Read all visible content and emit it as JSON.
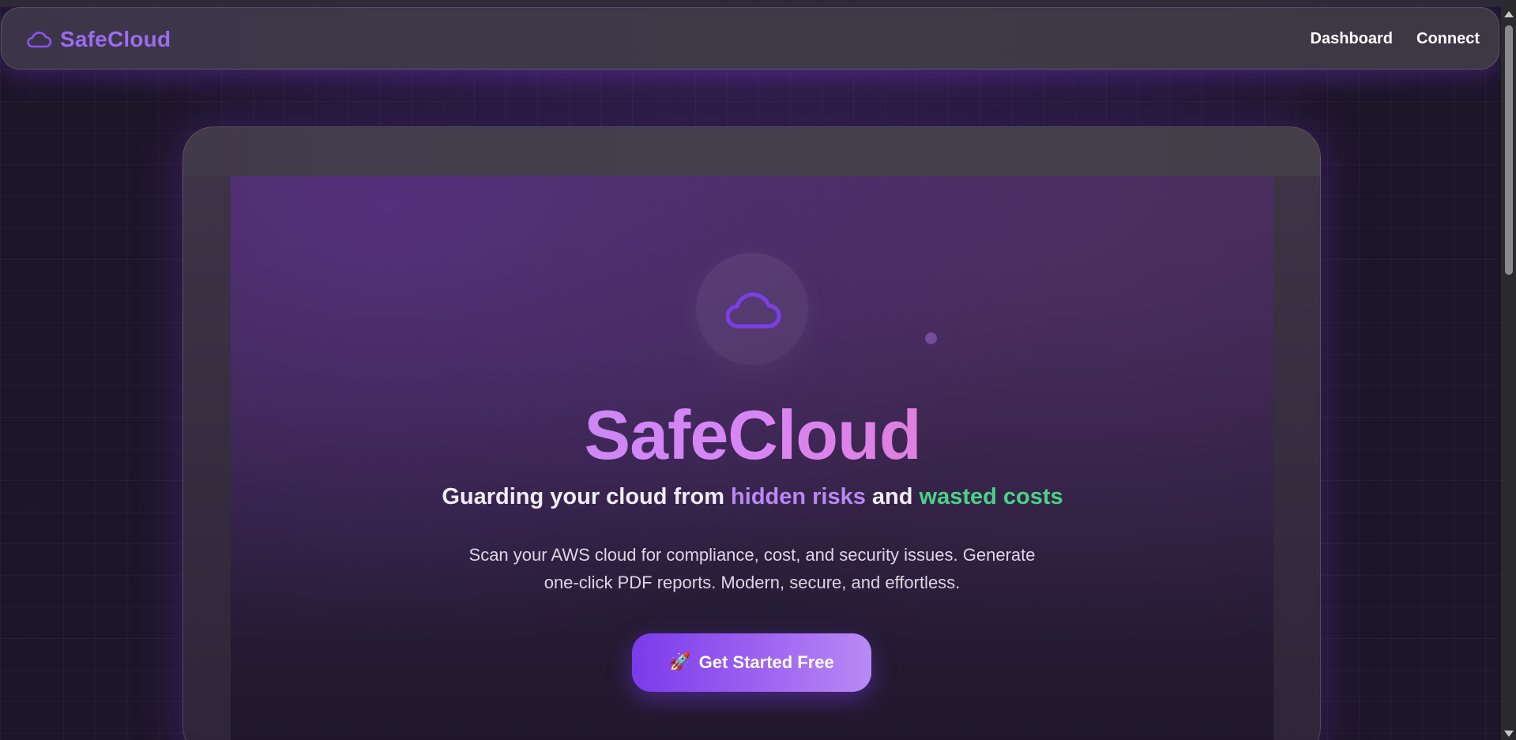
{
  "brand": {
    "name": "SafeCloud",
    "icon": "cloud-icon",
    "color": "#9b6cf0"
  },
  "nav": {
    "links": [
      {
        "label": "Dashboard"
      },
      {
        "label": "Connect"
      }
    ]
  },
  "hero": {
    "icon": "cloud-icon",
    "title": "SafeCloud",
    "tagline": {
      "prefix": "Guarding your cloud from ",
      "highlight1": "hidden risks",
      "middle": " and ",
      "highlight2": "wasted costs"
    },
    "description": "Scan your AWS cloud for compliance, cost, and security issues. Generate one-click PDF reports. Modern, secure, and effortless.",
    "cta": {
      "icon": "rocket-icon",
      "icon_glyph": "🚀",
      "label": "Get Started Free"
    }
  },
  "colors": {
    "accent_purple": "#9b6cf0",
    "highlight_purple": "#b889f5",
    "highlight_green": "#4ad388",
    "title_gradient": [
      "#b08cf8",
      "#d885f4",
      "#f071ad"
    ],
    "background": "#1c1528"
  }
}
